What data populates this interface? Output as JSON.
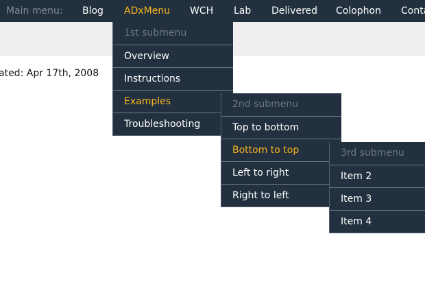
{
  "main_menu": {
    "label": "Main menu:",
    "items": [
      {
        "label": "Blog"
      },
      {
        "label": "ADxMenu",
        "active": true
      },
      {
        "label": "WCH"
      },
      {
        "label": "Lab"
      },
      {
        "label": "Delivered"
      },
      {
        "label": "Colophon"
      },
      {
        "label": "Conta"
      }
    ]
  },
  "content": {
    "updated": "ated: Apr 17th, 2008"
  },
  "submenu1": {
    "header": "1st submenu",
    "items": [
      {
        "label": "Overview"
      },
      {
        "label": "Instructions"
      },
      {
        "label": "Examples",
        "active": true
      },
      {
        "label": "Troubleshooting"
      }
    ]
  },
  "submenu2": {
    "header": "2nd submenu",
    "items": [
      {
        "label": "Top to bottom"
      },
      {
        "label": "Bottom to top",
        "active": true
      },
      {
        "label": "Left to right"
      },
      {
        "label": "Right to left"
      }
    ]
  },
  "submenu3": {
    "header": "3rd submenu",
    "items": [
      {
        "label": "Item 2"
      },
      {
        "label": "Item 3"
      },
      {
        "label": "Item 4"
      }
    ]
  },
  "colors": {
    "bar": "#22303f",
    "active": "#f8b51c",
    "muted": "#7f8a96",
    "band": "#efefef"
  }
}
